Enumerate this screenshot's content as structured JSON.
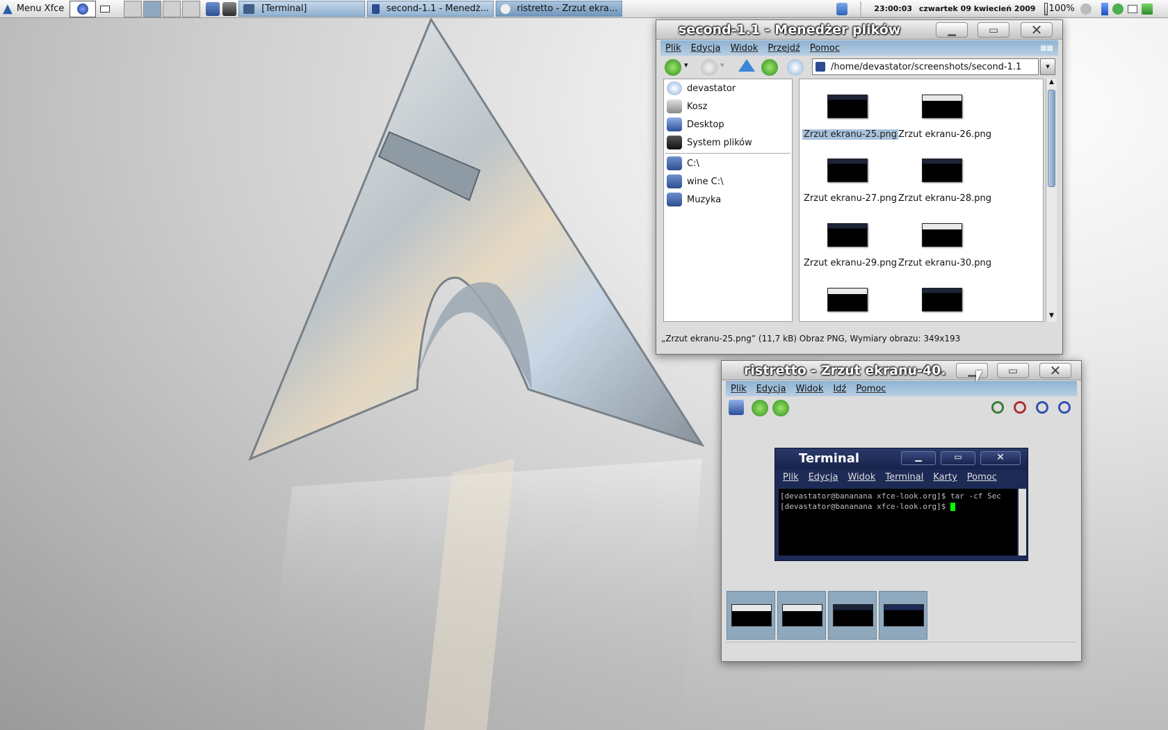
{
  "panel": {
    "menu_label": "Menu Xfce",
    "tasks": [
      {
        "label": "[Terminal]"
      },
      {
        "label": "second-1.1 - Menedż..."
      },
      {
        "label": "ristretto - Zrzut ekra..."
      }
    ],
    "clock": "23:00:03",
    "date": "czwartek 09 kwiecień 2009",
    "battery": "100%"
  },
  "filemanager": {
    "title": "second-1.1 - Menedżer plików",
    "menu": [
      "Plik",
      "Edycja",
      "Widok",
      "Przejdź",
      "Pomoc"
    ],
    "path": "/home/devastator/screenshots/second-1.1",
    "sidebar": [
      {
        "label": "devastator",
        "icon": "home-icon"
      },
      {
        "label": "Kosz",
        "icon": "trash-icon"
      },
      {
        "label": "Desktop",
        "icon": "desktop-icon"
      },
      {
        "label": "System plików",
        "icon": "drive-icon"
      },
      {
        "label": "C:\\",
        "icon": "folder-icon"
      },
      {
        "label": "wine C:\\",
        "icon": "folder-icon"
      },
      {
        "label": "Muzyka",
        "icon": "music-folder-icon"
      }
    ],
    "files": [
      {
        "name": "Zrzut ekranu-25.png",
        "selected": true
      },
      {
        "name": "Zrzut ekranu-26.png",
        "selected": false
      },
      {
        "name": "Zrzut ekranu-27.png",
        "selected": false
      },
      {
        "name": "Zrzut ekranu-28.png",
        "selected": false
      },
      {
        "name": "Zrzut ekranu-29.png",
        "selected": false
      },
      {
        "name": "Zrzut ekranu-30.png",
        "selected": false
      }
    ],
    "status": "„Zrzut ekranu-25.png” (11,7 kB) Obraz PNG, Wymiary obrazu: 349x193"
  },
  "viewer": {
    "title": "ristretto - Zrzut ekranu-40.",
    "menu": [
      "Plik",
      "Edycja",
      "Widok",
      "Idź",
      "Pomoc"
    ]
  },
  "terminal_image": {
    "title": "Terminal",
    "menu": [
      "Plik",
      "Edycja",
      "Widok",
      "Terminal",
      "Karty",
      "Pomoc"
    ],
    "line1": "[devastator@bananana xfce-look.org]$ tar -cf Sec",
    "line2": "[devastator@bananana xfce-look.org]$ "
  },
  "colors": {
    "menubar": "#a6c2dc",
    "selection": "#a9c3dc",
    "terminal_bg": "#000000",
    "cursor": "#00ff00"
  }
}
